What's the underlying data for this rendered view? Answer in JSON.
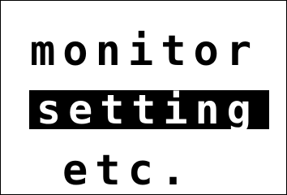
{
  "menu": {
    "items": [
      {
        "label": "monitor",
        "selected": false
      },
      {
        "label": "setting",
        "selected": true
      },
      {
        "label": "etc.",
        "selected": false
      }
    ]
  },
  "colors": {
    "background": "#ffffff",
    "text": "#000000",
    "selection_background": "#000000",
    "selection_text": "#ffffff"
  }
}
